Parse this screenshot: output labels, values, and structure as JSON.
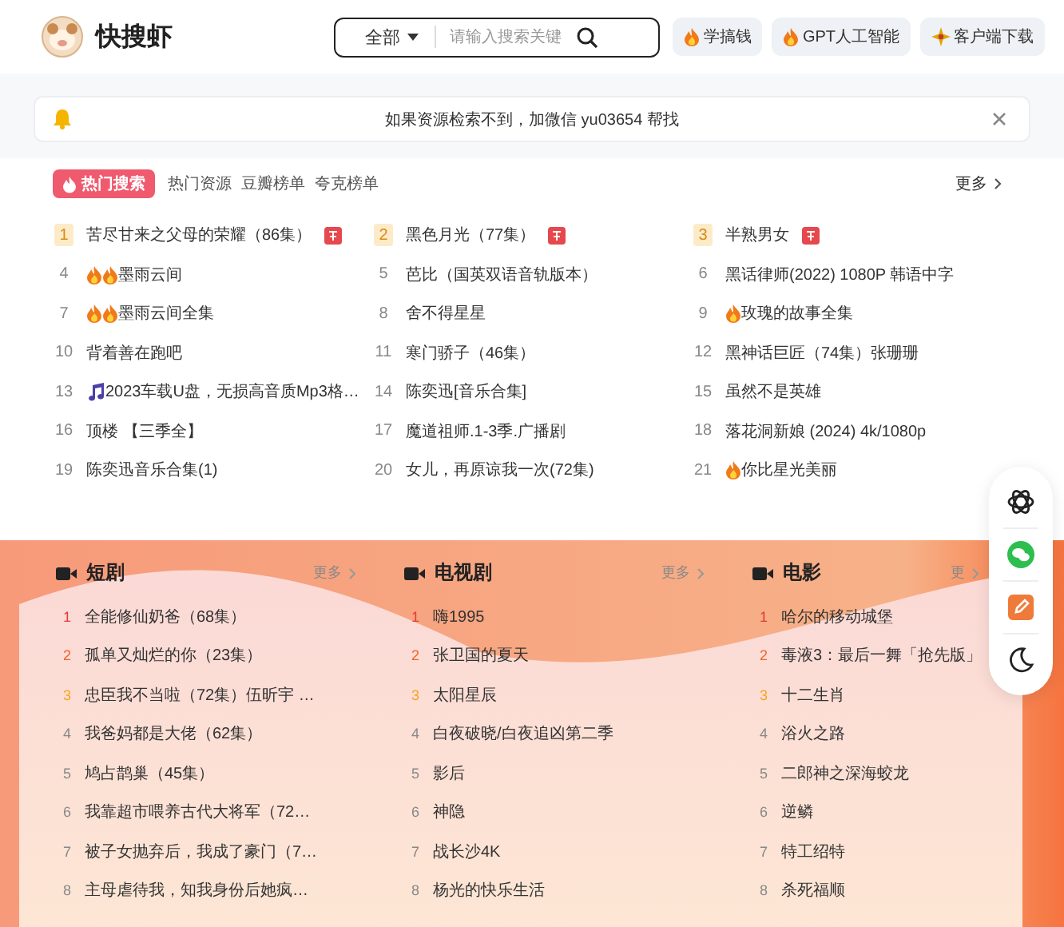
{
  "header": {
    "logo": "快搜虾",
    "search": {
      "scope": "全部",
      "placeholder": "请输入搜索关键"
    },
    "buttons": [
      {
        "kind": "flame",
        "label": "学搞钱"
      },
      {
        "kind": "flame",
        "label": "GPT人工智能"
      },
      {
        "kind": "star",
        "label": "客户端下载"
      }
    ]
  },
  "notice": {
    "text": "如果资源检索不到，加微信 yu03654 帮找"
  },
  "hot": {
    "tabs": [
      {
        "label": "热门搜索",
        "selected": true
      },
      {
        "label": "热门资源",
        "selected": false
      },
      {
        "label": "豆瓣榜单",
        "selected": false
      },
      {
        "label": "夸克榜单",
        "selected": false
      }
    ],
    "more": "更多",
    "items": [
      {
        "rank": "1",
        "title": "苦尽甘来之父母的荣耀（86集）",
        "kind": "plain",
        "hot": true
      },
      {
        "rank": "2",
        "title": "黑色月光（77集）",
        "kind": "plain",
        "hot": true
      },
      {
        "rank": "3",
        "title": "半熟男女",
        "kind": "plain",
        "hot": true
      },
      {
        "rank": "4",
        "title": "墨雨云间",
        "kind": "flames",
        "hot": false
      },
      {
        "rank": "5",
        "title": "芭比（国英双语音轨版本）",
        "kind": "plain",
        "hot": false
      },
      {
        "rank": "6",
        "title": "黑话律师(2022) 1080P 韩语中字",
        "kind": "plain",
        "hot": false
      },
      {
        "rank": "7",
        "title": "墨雨云间全集",
        "kind": "flames",
        "hot": false
      },
      {
        "rank": "8",
        "title": "舍不得星星",
        "kind": "plain",
        "hot": false
      },
      {
        "rank": "9",
        "title": "玫瑰的故事全集",
        "kind": "flame",
        "hot": false
      },
      {
        "rank": "10",
        "title": "背着善在跑吧",
        "kind": "plain",
        "hot": false
      },
      {
        "rank": "11",
        "title": "寒门骄子（46集）",
        "kind": "plain",
        "hot": false
      },
      {
        "rank": "12",
        "title": "黑神话巨匠（74集）张珊珊",
        "kind": "plain",
        "hot": false
      },
      {
        "rank": "13",
        "title": "2023车载U盘，无损高音质Mp3格…",
        "kind": "music",
        "hot": false
      },
      {
        "rank": "14",
        "title": "陈奕迅[音乐合集]",
        "kind": "plain",
        "hot": false
      },
      {
        "rank": "15",
        "title": "虽然不是英雄",
        "kind": "plain",
        "hot": false
      },
      {
        "rank": "16",
        "title": "顶楼 【三季全】",
        "kind": "plain",
        "hot": false
      },
      {
        "rank": "17",
        "title": "魔道祖师.1-3季.广播剧",
        "kind": "plain",
        "hot": false
      },
      {
        "rank": "18",
        "title": "落花洞新娘 (2024) 4k/1080p",
        "kind": "plain",
        "hot": false
      },
      {
        "rank": "19",
        "title": "陈奕迅音乐合集(1)",
        "kind": "plain",
        "hot": false
      },
      {
        "rank": "20",
        "title": "女儿，再原谅我一次(72集)",
        "kind": "plain",
        "hot": false
      },
      {
        "rank": "21",
        "title": "你比星光美丽",
        "kind": "flame",
        "hot": false
      }
    ]
  },
  "categories": [
    {
      "title": "短剧",
      "more": "更多",
      "items": [
        {
          "rank": "1",
          "title": "全能修仙奶爸（68集）"
        },
        {
          "rank": "2",
          "title": "孤单又灿烂的你（23集）"
        },
        {
          "rank": "3",
          "title": "忠臣我不当啦（72集）伍昕宇 …"
        },
        {
          "rank": "4",
          "title": "我爸妈都是大佬（62集）"
        },
        {
          "rank": "5",
          "title": "鸠占鹊巢（45集）"
        },
        {
          "rank": "6",
          "title": "我靠超市喂养古代大将军（72…"
        },
        {
          "rank": "7",
          "title": "被子女抛弃后，我成了豪门（7…"
        },
        {
          "rank": "8",
          "title": "主母虐待我，知我身份后她疯…"
        }
      ]
    },
    {
      "title": "电视剧",
      "more": "更多",
      "items": [
        {
          "rank": "1",
          "title": "嗨1995"
        },
        {
          "rank": "2",
          "title": "张卫国的夏天"
        },
        {
          "rank": "3",
          "title": "太阳星辰"
        },
        {
          "rank": "4",
          "title": "白夜破晓/白夜追凶第二季"
        },
        {
          "rank": "5",
          "title": "影后"
        },
        {
          "rank": "6",
          "title": "神隐"
        },
        {
          "rank": "7",
          "title": "战长沙4K"
        },
        {
          "rank": "8",
          "title": "杨光的快乐生活"
        }
      ]
    },
    {
      "title": "电影",
      "more": "更",
      "items": [
        {
          "rank": "1",
          "title": "哈尔的移动城堡"
        },
        {
          "rank": "2",
          "title": "毒液3：最后一舞「抢先版」"
        },
        {
          "rank": "3",
          "title": "十二生肖"
        },
        {
          "rank": "4",
          "title": "浴火之路"
        },
        {
          "rank": "5",
          "title": "二郎神之深海蛟龙"
        },
        {
          "rank": "6",
          "title": "逆鳞"
        },
        {
          "rank": "7",
          "title": "特工绍特"
        },
        {
          "rank": "8",
          "title": "杀死福顺"
        }
      ]
    }
  ],
  "side_tools": [
    {
      "kind": "knot"
    },
    {
      "kind": "chat"
    },
    {
      "kind": "edit"
    },
    {
      "kind": "moon"
    }
  ]
}
